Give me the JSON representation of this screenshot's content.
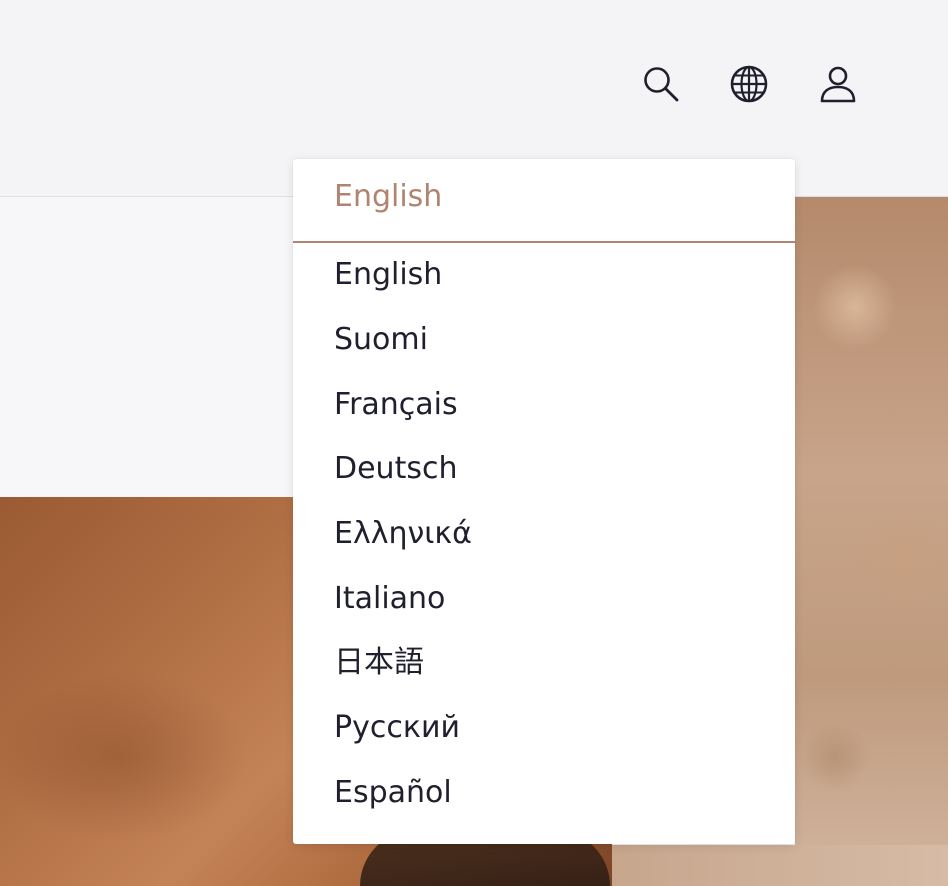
{
  "header": {
    "icons": {
      "search": "search-icon",
      "language": "globe-icon",
      "account": "user-icon"
    }
  },
  "language_menu": {
    "current": "English",
    "accent_color": "#b08470",
    "text_color": "#1f1f2e",
    "options": [
      "English",
      "Suomi",
      "Français",
      "Deutsch",
      "Ελληνικά",
      "Italiano",
      "日本語",
      "Русский",
      "Español"
    ]
  }
}
